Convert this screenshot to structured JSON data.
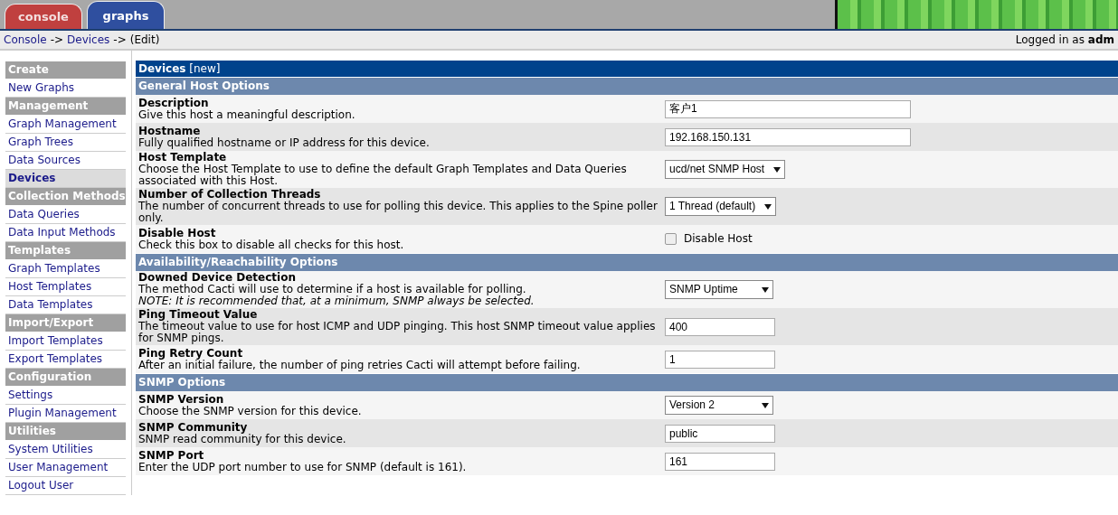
{
  "tabs": [
    {
      "label": "console",
      "selected": false,
      "color": "#c0403f"
    },
    {
      "label": "graphs",
      "selected": true,
      "color": "#2f4f9f"
    }
  ],
  "breadcrumb": [
    {
      "label": "Console",
      "kind": "link"
    },
    {
      "label": "->",
      "kind": "sep"
    },
    {
      "label": "Devices",
      "kind": "link"
    },
    {
      "label": "->",
      "kind": "sep"
    },
    {
      "label": "(Edit)",
      "kind": "text"
    }
  ],
  "login": "Logged in as **adm**",
  "sidebar": [
    {
      "label": "Create",
      "kind": "header"
    },
    {
      "label": "New Graphs",
      "kind": "link",
      "selected": false
    },
    {
      "label": "Management",
      "kind": "header"
    },
    {
      "label": "Graph Management",
      "kind": "link",
      "selected": false
    },
    {
      "label": "Graph Trees",
      "kind": "link",
      "selected": false
    },
    {
      "label": "Data Sources",
      "kind": "link",
      "selected": false
    },
    {
      "label": "Devices",
      "kind": "link",
      "selected": true
    },
    {
      "label": "Collection Methods",
      "kind": "header"
    },
    {
      "label": "Data Queries",
      "kind": "link",
      "selected": false
    },
    {
      "label": "Data Input Methods",
      "kind": "link",
      "selected": false
    },
    {
      "label": "Templates",
      "kind": "header"
    },
    {
      "label": "Graph Templates",
      "kind": "link",
      "selected": false
    },
    {
      "label": "Host Templates",
      "kind": "link",
      "selected": false
    },
    {
      "label": "Data Templates",
      "kind": "link",
      "selected": false
    },
    {
      "label": "Import/Export",
      "kind": "header"
    },
    {
      "label": "Import Templates",
      "kind": "link",
      "selected": false
    },
    {
      "label": "Export Templates",
      "kind": "link",
      "selected": false
    },
    {
      "label": "Configuration",
      "kind": "header"
    },
    {
      "label": "Settings",
      "kind": "link",
      "selected": false
    },
    {
      "label": "Plugin Management",
      "kind": "link",
      "selected": false
    },
    {
      "label": "Utilities",
      "kind": "header"
    },
    {
      "label": "System Utilities",
      "kind": "link",
      "selected": false
    },
    {
      "label": "User Management",
      "kind": "link",
      "selected": false
    },
    {
      "label": "Logout User",
      "kind": "link",
      "selected": false
    }
  ],
  "form": {
    "title": "Devices",
    "title_suffix": "[new]",
    "sections": [
      {
        "title": "General Host Options",
        "rows": [
          {
            "label": "Description",
            "description": "Give this host a meaningful description.",
            "kind": "text",
            "value": "客户1"
          },
          {
            "label": "Hostname",
            "description": "Fully qualified hostname or IP address for this device.",
            "kind": "text",
            "value": "192.168.150.131"
          },
          {
            "label": "Host Template",
            "description": "Choose the Host Template to use to define the default Graph Templates and Data Queries associated with this Host.",
            "kind": "select",
            "value": "ucd/net SNMP Host"
          },
          {
            "label": "Number of Collection Threads",
            "description": "The number of concurrent threads to use for polling this device. This applies to the Spine poller only.",
            "kind": "select",
            "value": "1 Thread (default)"
          },
          {
            "label": "Disable Host",
            "description": "Check this box to disable all checks for this host.",
            "kind": "checkbox",
            "value": "Disable Host",
            "checked": false
          }
        ]
      },
      {
        "title": "Availability/Reachability Options",
        "rows": [
          {
            "label": "Downed Device Detection",
            "description": "The method Cacti will use to determine if a host is available for polling.",
            "note": "NOTE: It is recommended that, at a minimum, SNMP always be selected.",
            "kind": "select",
            "value": "SNMP Uptime"
          },
          {
            "label": "Ping Timeout Value",
            "description": "The timeout value to use for host ICMP and UDP pinging. This host SNMP timeout value applies for SNMP pings.",
            "kind": "text",
            "value": "400"
          },
          {
            "label": "Ping Retry Count",
            "description": "After an initial failure, the number of ping retries Cacti will attempt before failing.",
            "kind": "text",
            "value": "1"
          }
        ]
      },
      {
        "title": "SNMP Options",
        "rows": [
          {
            "label": "SNMP Version",
            "description": "Choose the SNMP version for this device.",
            "kind": "select",
            "value": "Version 2"
          },
          {
            "label": "SNMP Community",
            "description": "SNMP read community for this device.",
            "kind": "text",
            "value": "public"
          },
          {
            "label": "SNMP Port",
            "description": "Enter the UDP port number to use for SNMP (default is 161).",
            "kind": "text",
            "value": "161"
          }
        ]
      }
    ]
  }
}
